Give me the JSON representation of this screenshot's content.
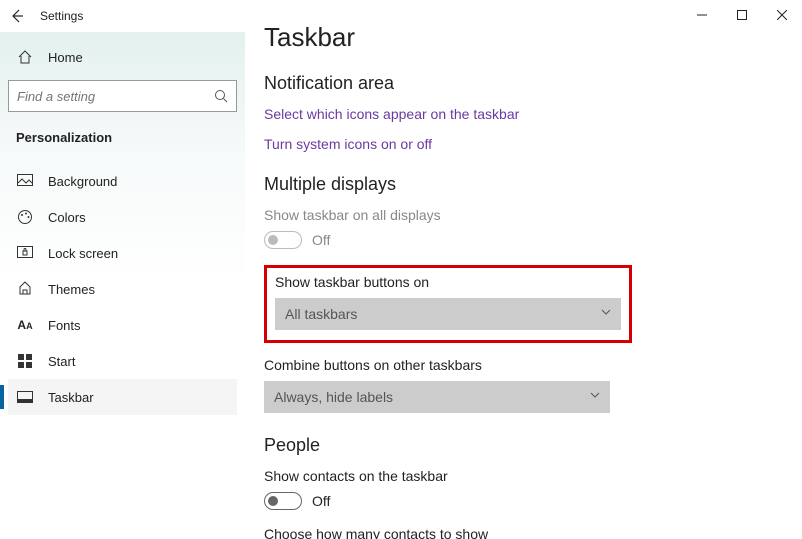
{
  "app": {
    "title": "Settings"
  },
  "search": {
    "placeholder": "Find a setting"
  },
  "home": {
    "label": "Home"
  },
  "sidebar": {
    "header": "Personalization",
    "items": [
      {
        "label": "Background"
      },
      {
        "label": "Colors"
      },
      {
        "label": "Lock screen"
      },
      {
        "label": "Themes"
      },
      {
        "label": "Fonts"
      },
      {
        "label": "Start"
      },
      {
        "label": "Taskbar"
      }
    ]
  },
  "page": {
    "title": "Taskbar",
    "notification": {
      "header": "Notification area",
      "link1": "Select which icons appear on the taskbar",
      "link2": "Turn system icons on or off"
    },
    "multi": {
      "header": "Multiple displays",
      "showAllLabel": "Show taskbar on all displays",
      "showAllState": "Off",
      "showButtonsLabel": "Show taskbar buttons on",
      "showButtonsValue": "All taskbars",
      "combineLabel": "Combine buttons on other taskbars",
      "combineValue": "Always, hide labels"
    },
    "people": {
      "header": "People",
      "showContactsLabel": "Show contacts on the taskbar",
      "showContactsState": "Off",
      "chooseLabel": "Choose how many contacts to show"
    }
  }
}
